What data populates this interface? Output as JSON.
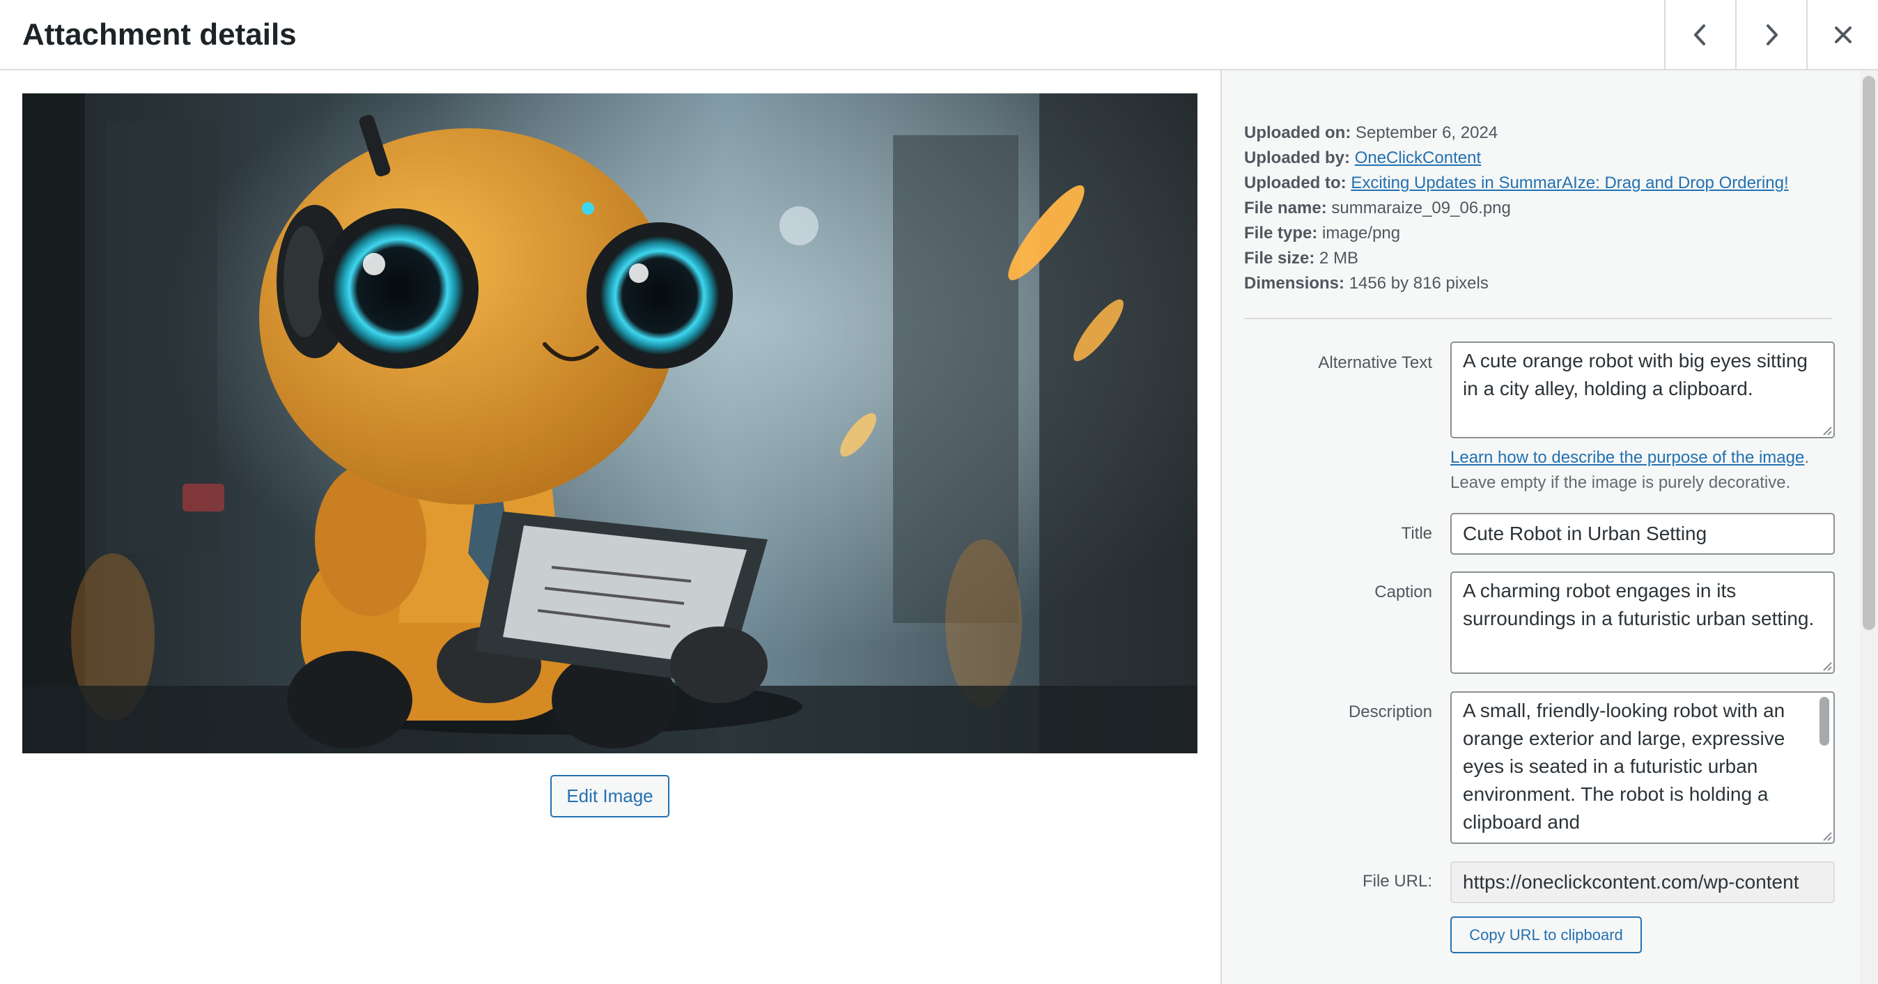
{
  "header": {
    "title": "Attachment details",
    "prev_icon": "chevron-left-icon",
    "next_icon": "chevron-right-icon",
    "close_icon": "close-icon"
  },
  "media": {
    "image_alt": "A cute orange robot with big eyes sitting in a city alley, holding a clipboard.",
    "edit_button": "Edit Image"
  },
  "details": {
    "uploaded_on_label": "Uploaded on:",
    "uploaded_on": "September 6, 2024",
    "uploaded_by_label": "Uploaded by:",
    "uploaded_by": "OneClickContent",
    "uploaded_to_label": "Uploaded to:",
    "uploaded_to": "Exciting Updates in SummarAIze: Drag and Drop Ordering!",
    "file_name_label": "File name:",
    "file_name": "summaraize_09_06.png",
    "file_type_label": "File type:",
    "file_type": "image/png",
    "file_size_label": "File size:",
    "file_size": "2 MB",
    "dimensions_label": "Dimensions:",
    "dimensions": "1456 by 816 pixels"
  },
  "fields": {
    "alt_label": "Alternative Text",
    "alt_value": "A cute orange robot with big eyes sitting in a city alley, holding a clipboard.",
    "alt_help_link": "Learn how to describe the purpose of the image",
    "alt_help_period": ".",
    "alt_help_text": "Leave empty if the image is purely decorative.",
    "title_label": "Title",
    "title_value": "Cute Robot in Urban Setting",
    "caption_label": "Caption",
    "caption_value": "A charming robot engages in its surroundings in a futuristic urban setting.",
    "description_label": "Description",
    "description_value": "A small, friendly-looking robot with an orange exterior and large, expressive eyes is seated in a futuristic urban environment. The robot is holding a clipboard and",
    "file_url_label": "File URL:",
    "file_url_value": "https://oneclickcontent.com/wp-content",
    "copy_button": "Copy URL to clipboard"
  },
  "colors": {
    "link": "#2271b1",
    "robot_orange": "#e59a2c",
    "eye_glow": "#3fd7f0"
  }
}
